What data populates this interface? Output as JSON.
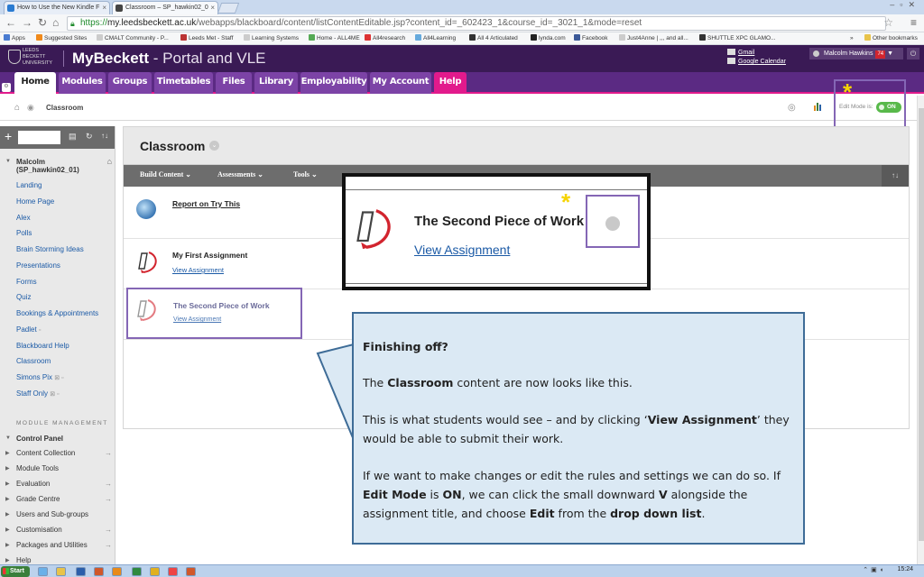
{
  "browser": {
    "tabs": [
      {
        "label": "How to Use the New Kindle F",
        "color": "#2a7bd1"
      },
      {
        "label": "Classroom – SP_hawkin02_0",
        "color": "#444444"
      }
    ],
    "url": {
      "scheme": "https://",
      "host": "my.leedsbeckett.ac.uk",
      "path": "/webapps/blackboard/content/listContentEditable.jsp?content_id=_602423_1&course_id=_3021_1&mode=reset"
    },
    "bookmarks": [
      "Apps",
      "Suggested Sites",
      "CMALT Community - P...",
      "Leeds Met - Staff",
      "Learning Systems",
      "Home - ALL4ME",
      "All4research",
      "All4Learning",
      "All 4 Articulated",
      "lynda.com",
      "Facebook",
      "Just4Anne | ,,, and all...",
      "SHUTTLE XPC GLAMO..."
    ],
    "other_bookmarks": "Other bookmarks",
    "overflow": "»"
  },
  "header": {
    "uni_logo_lines": [
      "LEEDS",
      "BECKETT",
      "UNIVERSITY"
    ],
    "brand_main": "MyBeckett",
    "brand_sub": " - Portal and VLE",
    "gmail": "Gmail",
    "google_calendar": "Google Calendar",
    "user_name": "Malcolm Hawkins",
    "notifications": "74",
    "caret": "▼"
  },
  "tabs": [
    "Home",
    "Modules",
    "Groups",
    "Timetables",
    "Files",
    "Library",
    "Employability",
    "My Account",
    "Help"
  ],
  "breadcrumb": {
    "current": "Classroom"
  },
  "edit_mode": {
    "label": "Edit Mode is:",
    "state": "ON"
  },
  "sidebar": {
    "course": "Malcolm\n(SP_hawkin02_01)",
    "links": [
      "Landing",
      "Home Page",
      "Alex",
      "Polls",
      "Brain Storming Ideas",
      "Presentations",
      "Forms",
      "Quiz",
      "Bookings & Appointments",
      "Padlet",
      "Blackboard Help",
      "Classroom",
      "Simons Pix",
      "Staff Only"
    ],
    "module_management": "MODULE MANAGEMENT",
    "control_panel": [
      {
        "label": "Control Panel",
        "arrow": ""
      },
      {
        "label": "Content Collection",
        "arrow": "→"
      },
      {
        "label": "Module Tools",
        "arrow": ""
      },
      {
        "label": "Evaluation",
        "arrow": "→"
      },
      {
        "label": "Grade Centre",
        "arrow": "→"
      },
      {
        "label": "Users and Sub-groups",
        "arrow": ""
      },
      {
        "label": "Customisation",
        "arrow": "→"
      },
      {
        "label": "Packages and Utilities",
        "arrow": "→"
      },
      {
        "label": "Help",
        "arrow": ""
      }
    ]
  },
  "content": {
    "title": "Classroom",
    "actions": [
      "Build Content",
      "Assessments",
      "Tools"
    ],
    "sort_icon": "↑↓",
    "items": [
      {
        "title": "Report on Try This",
        "link": ""
      },
      {
        "title": "My First Assignment",
        "link": "View Assignment"
      },
      {
        "title": "The Second Piece of Work",
        "link": "View Assignment"
      }
    ]
  },
  "zoom": {
    "title": "The Second Piece of Work",
    "link": "View Assignment"
  },
  "bubble": {
    "heading": "Finishing off?",
    "p1_a": "The ",
    "p1_b": "Classroom",
    "p1_c": " content are now looks like this.",
    "p2_a": "This is what students would see – and by clicking ‘",
    "p2_b": "View Assignment",
    "p2_c": "’ they would be able to submit their work.",
    "p3_a": "If we want to make changes or edit the rules and settings we can do so. If ",
    "p3_b": "Edit Mode",
    "p3_c": " is ",
    "p3_d": "ON",
    "p3_e": ", we can click the small downward ",
    "p3_f": "V",
    "p3_g": " alongside the assignment title, and choose ",
    "p3_h": "Edit",
    "p3_i": " from the ",
    "p3_j": "drop down list",
    "p3_k": "."
  },
  "taskbar": {
    "start": "Start",
    "clock": "15:24"
  },
  "colors": {
    "header": "#3a1a55",
    "tab_bar": "#5b2a83",
    "tab": "#7c43a6",
    "help_tab": "#e21a8c",
    "highlight": "#8466b5",
    "bubble": "#dbe9f4",
    "toggle_on": "#58b94a"
  }
}
